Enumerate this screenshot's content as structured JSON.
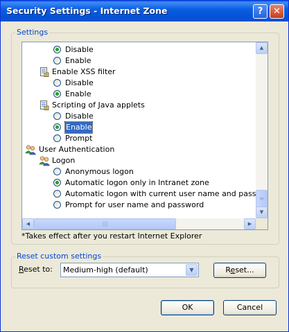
{
  "window": {
    "title": "Security Settings - Internet Zone",
    "help_glyph": "?",
    "close_glyph": "✕"
  },
  "settings_group": {
    "legend": "Settings",
    "tree": [
      {
        "kind": "radio",
        "label": "Disable",
        "checked": true
      },
      {
        "kind": "radio",
        "label": "Enable",
        "checked": false
      },
      {
        "kind": "category",
        "label": "Enable XSS filter",
        "icon": "doc-settings-icon"
      },
      {
        "kind": "radio",
        "label": "Disable",
        "checked": false
      },
      {
        "kind": "radio",
        "label": "Enable",
        "checked": true
      },
      {
        "kind": "category",
        "label": "Scripting of Java applets",
        "icon": "doc-settings-icon"
      },
      {
        "kind": "radio",
        "label": "Disable",
        "checked": false
      },
      {
        "kind": "radio",
        "label": "Enable",
        "checked": true,
        "selected": true
      },
      {
        "kind": "radio",
        "label": "Prompt",
        "checked": false
      },
      {
        "kind": "category",
        "label": "User Authentication",
        "icon": "users-icon"
      },
      {
        "kind": "subcategory",
        "label": "Logon",
        "icon": "users-icon"
      },
      {
        "kind": "radio",
        "label": "Anonymous logon",
        "checked": false
      },
      {
        "kind": "radio",
        "label": "Automatic logon only in Intranet zone",
        "checked": true
      },
      {
        "kind": "radio",
        "label": "Automatic logon with current user name and password",
        "checked": false
      },
      {
        "kind": "radio",
        "label": "Prompt for user name and password",
        "checked": false
      }
    ],
    "note": "*Takes effect after you restart Internet Explorer"
  },
  "reset_group": {
    "legend": "Reset custom settings",
    "reset_to_label_prefix": "R",
    "reset_to_label_rest": "eset to:",
    "selected_level": "Medium-high (default)",
    "reset_button_prefix": "R",
    "reset_button_accel": "e",
    "reset_button_rest": "set..."
  },
  "footer": {
    "ok_label": "OK",
    "cancel_label": "Cancel"
  },
  "colors": {
    "titlebar": "#0a5ee0",
    "legend_text": "#0046d5",
    "selection": "#316ac5",
    "radio_dot": "#21a121"
  }
}
